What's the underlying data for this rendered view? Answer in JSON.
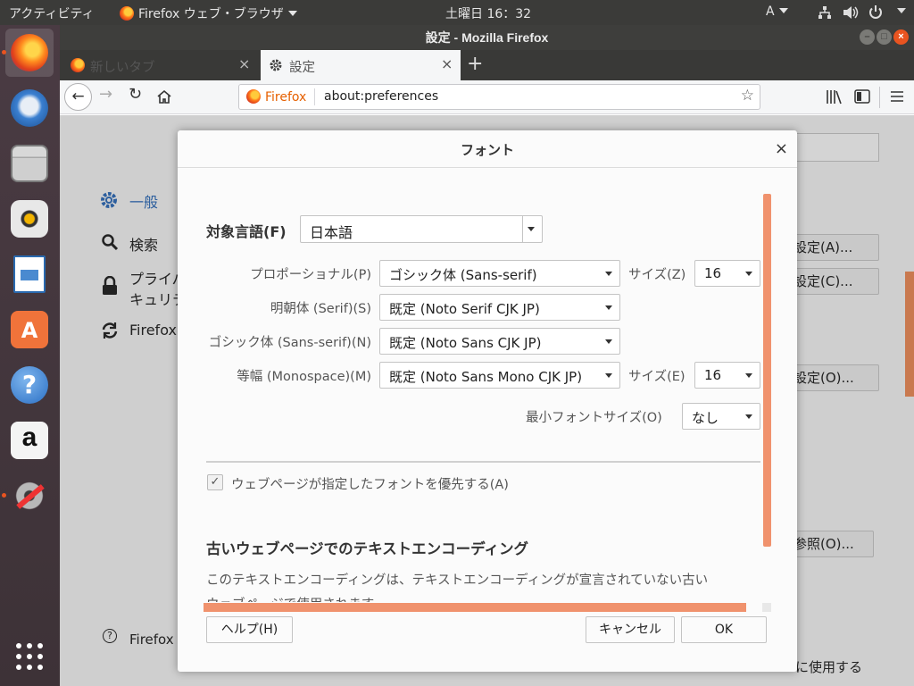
{
  "topbar": {
    "activities": "アクティビティ",
    "app_menu": "Firefox ウェブ・ブラウザ",
    "clock": "土曜日 16：32",
    "input_method": "A"
  },
  "launcher": {
    "items": [
      "firefox-icon",
      "thunderbird-icon",
      "files-icon",
      "rhythmbox-icon",
      "writer-icon",
      "software-center-icon",
      "help-icon",
      "amazon-icon",
      "system-settings-icon",
      "show-apps-icon"
    ],
    "amazon_glyph": "a",
    "help_glyph": "?",
    "software_glyph": "A"
  },
  "window": {
    "title": "設定 - Mozilla Firefox",
    "tabs": [
      {
        "label": "新しいタブ",
        "active": false
      },
      {
        "label": "設定",
        "active": true
      }
    ],
    "new_tab_glyph": "+",
    "url_brand": "Firefox",
    "url": "about:preferences"
  },
  "prefs_background": {
    "nav_general": "一般",
    "nav_search": "検索",
    "nav_privacy_1": "プライバ",
    "nav_privacy_2": "キュリテ",
    "nav_sync": "Firefox",
    "support": "Firefox サ",
    "btn_advanced_a": "設定(A)...",
    "btn_advanced_c": "設定(C)...",
    "btn_advanced_o": "設定(O)...",
    "btn_browse": "参照(O)...",
    "bottom_text": "に使用する"
  },
  "dialog": {
    "title": "フォント",
    "target_language_label": "対象言語(F)",
    "target_language_value": "日本語",
    "rows": [
      {
        "label": "プロポーショナル(P)",
        "value": "ゴシック体 (Sans-serif)",
        "size_label": "サイズ(Z)",
        "size_value": "16"
      },
      {
        "label": "明朝体 (Serif)(S)",
        "value": "既定 (Noto Serif CJK JP)"
      },
      {
        "label": "ゴシック体 (Sans-serif)(N)",
        "value": "既定 (Noto Sans CJK JP)"
      },
      {
        "label": "等幅 (Monospace)(M)",
        "value": "既定 (Noto Sans Mono CJK JP)",
        "size_label": "サイズ(E)",
        "size_value": "16"
      }
    ],
    "min_font_label": "最小フォントサイズ(O)",
    "min_font_value": "なし",
    "allow_fonts_label": "ウェブページが指定したフォントを優先する(A)",
    "allow_fonts_checked": true,
    "encoding_heading": "古いウェブページでのテキストエンコーディング",
    "encoding_desc": "このテキストエンコーディングは、テキストエンコーディングが宣言されていない古い",
    "encoding_desc_cut": "ウェブページで使用されます。",
    "help_button": "ヘルプ(H)",
    "cancel_button": "キャンセル",
    "ok_button": "OK"
  },
  "colors": {
    "accent_orange": "#f0926d",
    "ubuntu_orange": "#e95420",
    "topbar": "#3b3b39"
  }
}
